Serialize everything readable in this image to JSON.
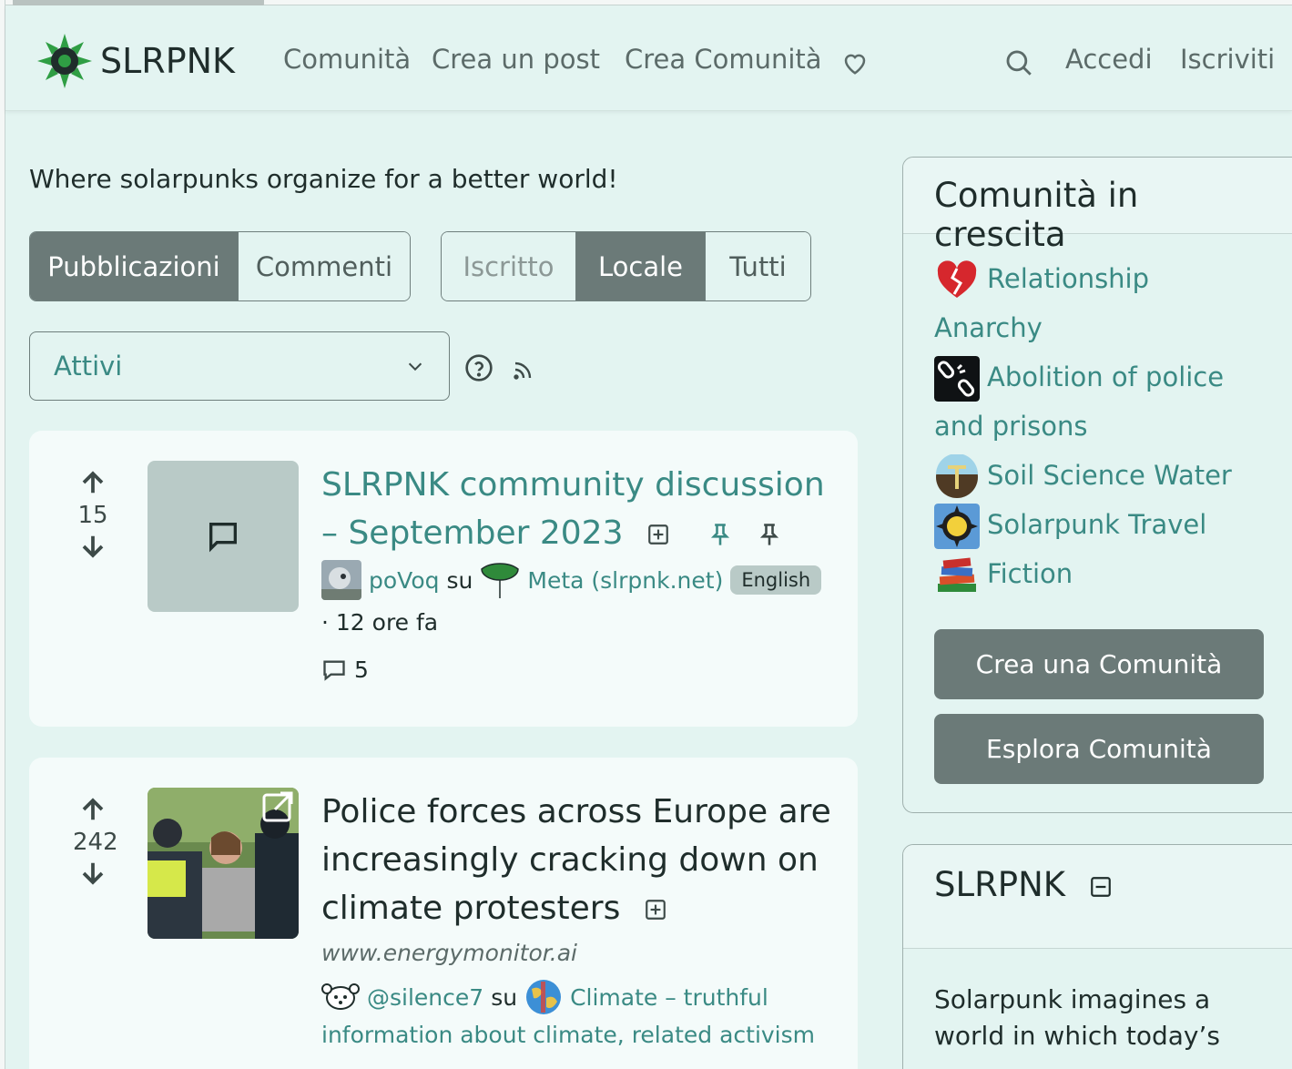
{
  "nav": {
    "brand": "SLRPNK",
    "links": [
      "Comunità",
      "Crea un post",
      "Crea Comunità"
    ],
    "login": "Accedi",
    "signup": "Iscriviti"
  },
  "tagline": "Where solarpunks organize for a better world!",
  "view_toggle": [
    "Pubblicazioni",
    "Commenti"
  ],
  "listing_toggle": [
    "Iscritto",
    "Locale",
    "Tutti"
  ],
  "sort": {
    "selected": "Attivi"
  },
  "posts": [
    {
      "score": "15",
      "title_line1": "SLRPNK community discussion",
      "title_line2": "– September 2023",
      "author": "poVoq",
      "su": "su",
      "community": "Meta (slrpnk.net)",
      "language": "English",
      "time": "· 12 ore fa",
      "comments": "5"
    },
    {
      "score": "242",
      "title_line1": "Police forces across Europe are",
      "title_line2": "increasingly cracking down on",
      "title_line3": "climate protesters",
      "domain": "www.energymonitor.ai",
      "author": "@silence7",
      "su": "su",
      "community_line1": "Climate – truthful",
      "community_line2": "information about climate, related activism"
    }
  ],
  "sidebar": {
    "trending_title": "Comunità in crescita",
    "communities": [
      {
        "line1": "Relationship",
        "line2": "Anarchy"
      },
      {
        "line1": "Abolition of police",
        "line2": "and prisons"
      },
      {
        "line1": "Soil Science  Water",
        "line2": ""
      },
      {
        "line1": "Solarpunk Travel",
        "line2": ""
      },
      {
        "line1": "Fiction",
        "line2": ""
      }
    ],
    "create_btn": "Crea una Comunità",
    "explore_btn": "Esplora Comunità",
    "site_title": "SLRPNK",
    "site_desc_line1": "Solarpunk imagines a",
    "site_desc_line2": "world in which today’s"
  },
  "colors": {
    "background": "#e3f4f1",
    "accent": "#3a8a84",
    "button": "#6b7a78"
  }
}
